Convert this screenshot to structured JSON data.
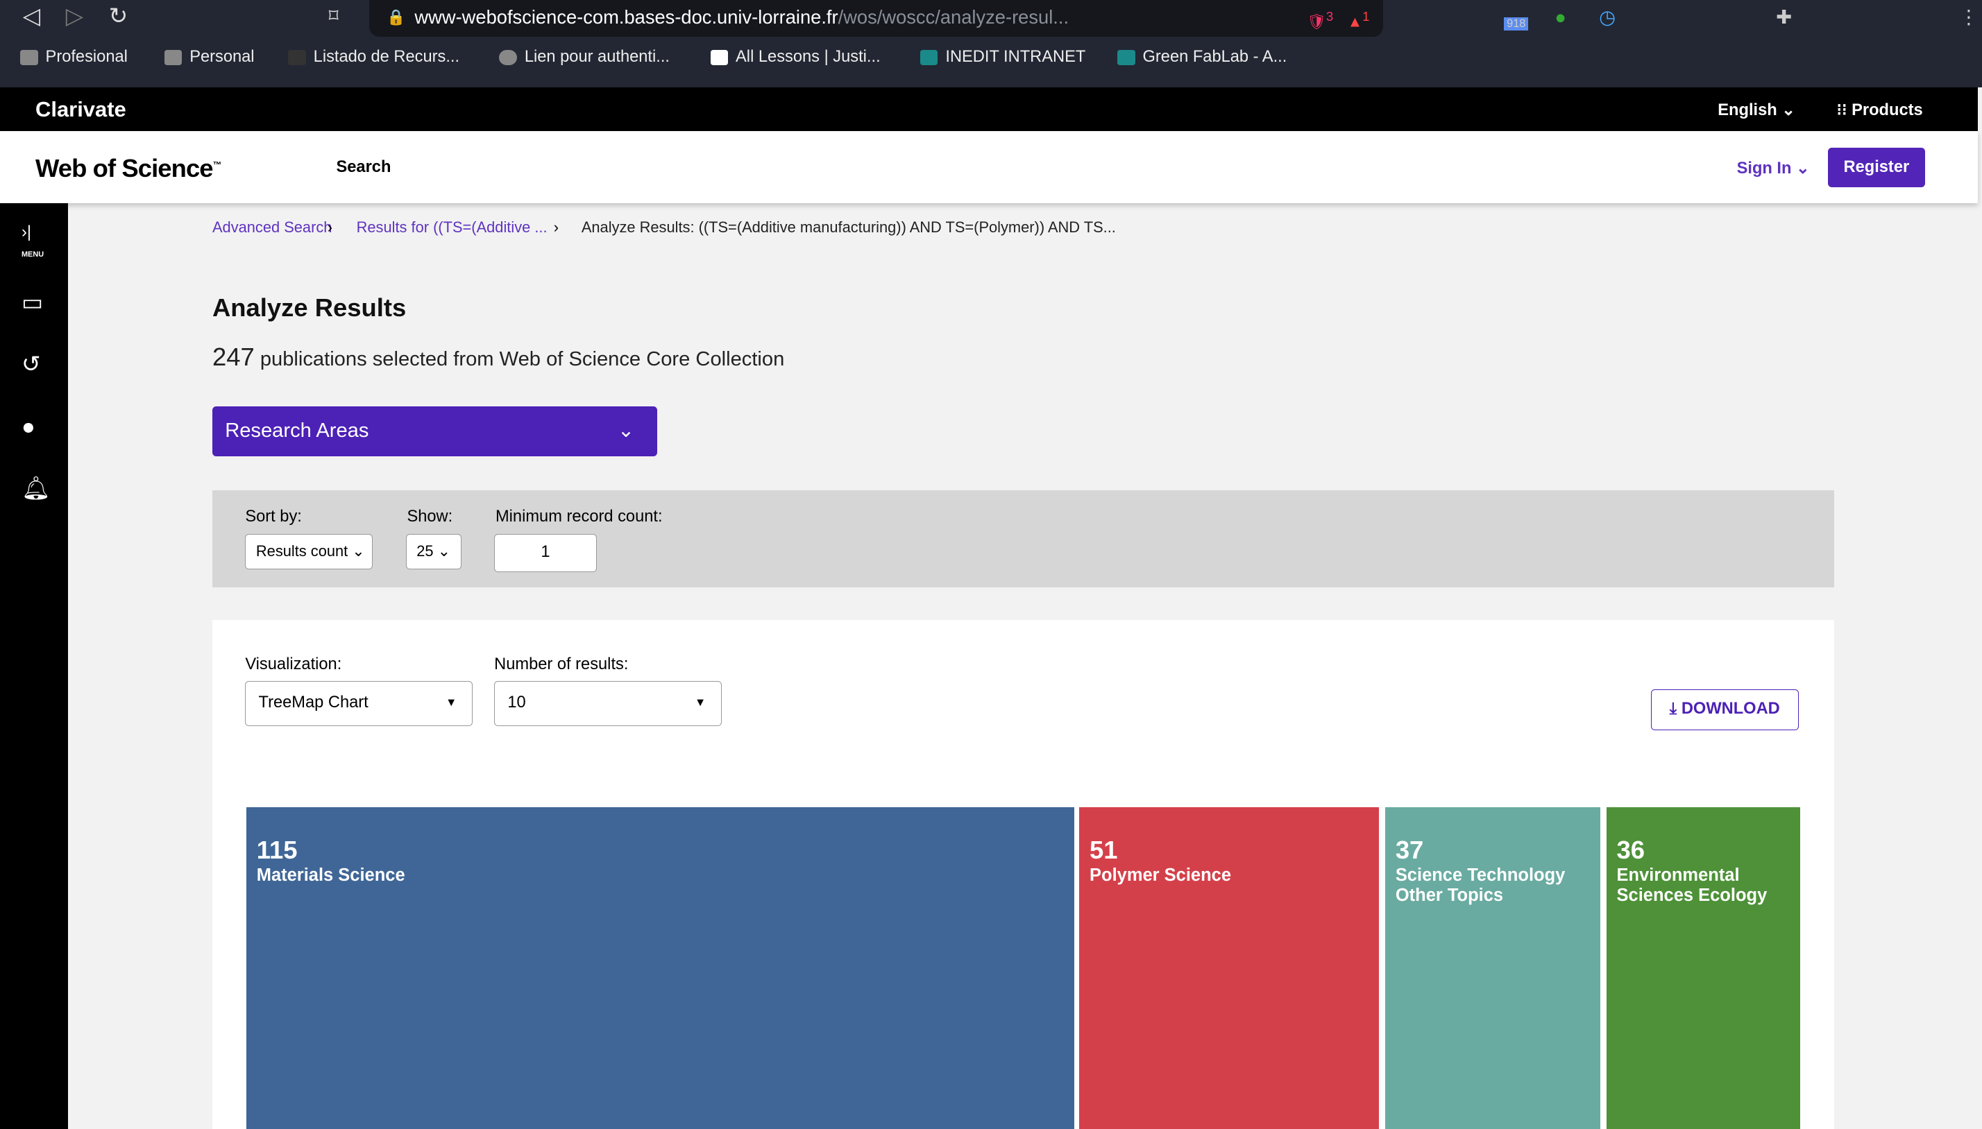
{
  "browser": {
    "url_host": "www-webofscience-com.bases-doc.univ-lorraine.fr",
    "url_path": "/wos/woscc/analyze-resul...",
    "ext_badge": "918",
    "brave_badge": "3",
    "alert_badge": "1",
    "bookmarks": [
      "Profesional",
      "Personal",
      "Listado de Recurs...",
      "Lien pour authenti...",
      "All Lessons | Justi...",
      "INEDIT INTRANET",
      "Green FabLab - A..."
    ]
  },
  "clarivate": {
    "logo": "Clarivate",
    "language": "English",
    "products": "Products"
  },
  "wos": {
    "logo": "Web of Science",
    "tm": "™",
    "search": "Search",
    "sign_in": "Sign In",
    "register": "Register"
  },
  "sidebar": {
    "menu": "MENU"
  },
  "breadcrumb": {
    "advanced": "Advanced Search",
    "results": "Results for ((TS=(Additive ...",
    "current": "Analyze Results: ((TS=(Additive manufacturing)) AND TS=(Polymer)) AND TS..."
  },
  "page": {
    "title": "Analyze Results",
    "count": "247",
    "count_text": "publications selected from Web of Science Core Collection",
    "field": "Research Areas"
  },
  "filters": {
    "sort_label": "Sort by:",
    "sort_value": "Results count",
    "show_label": "Show:",
    "show_value": "25",
    "min_label": "Minimum record count:",
    "min_value": "1"
  },
  "viz": {
    "viz_label": "Visualization:",
    "viz_value": "TreeMap Chart",
    "num_label": "Number of results:",
    "num_value": "10",
    "download": "DOWNLOAD"
  },
  "chart_data": {
    "type": "treemap",
    "categories": [
      "Materials Science",
      "Polymer Science",
      "Science Technology Other Topics",
      "Environmental Sciences Ecology"
    ],
    "values": [
      115,
      51,
      37,
      36
    ],
    "colors": [
      "#3f6696",
      "#d4404a",
      "#6aaba1",
      "#4e9138"
    ]
  }
}
